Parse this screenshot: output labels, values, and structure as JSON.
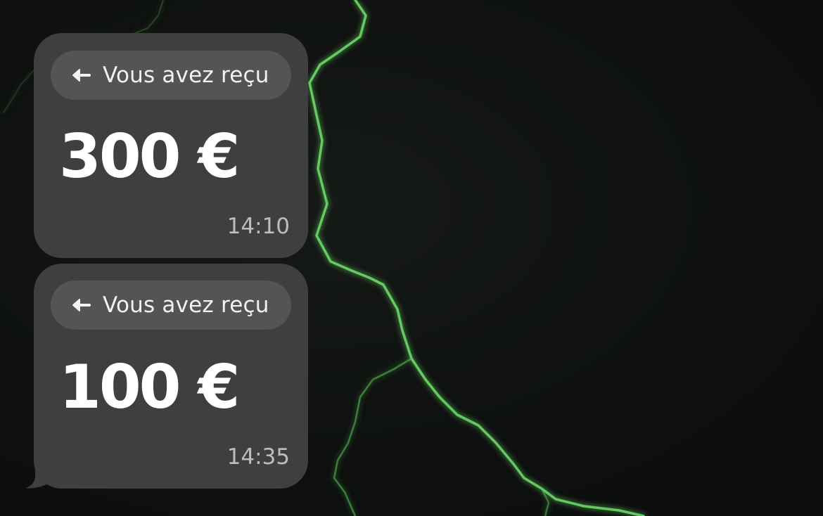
{
  "messages": [
    {
      "label": "Vous avez reçu",
      "icon": "arrow-left-icon",
      "amount": "300 €",
      "time": "14:10"
    },
    {
      "label": "Vous avez reçu",
      "icon": "arrow-left-icon",
      "amount": "100 €",
      "time": "14:35"
    }
  ],
  "colors": {
    "background": "#101311",
    "bubble": "#3f3f3f",
    "pill": "#545454",
    "lightning": "#5fd35a"
  }
}
